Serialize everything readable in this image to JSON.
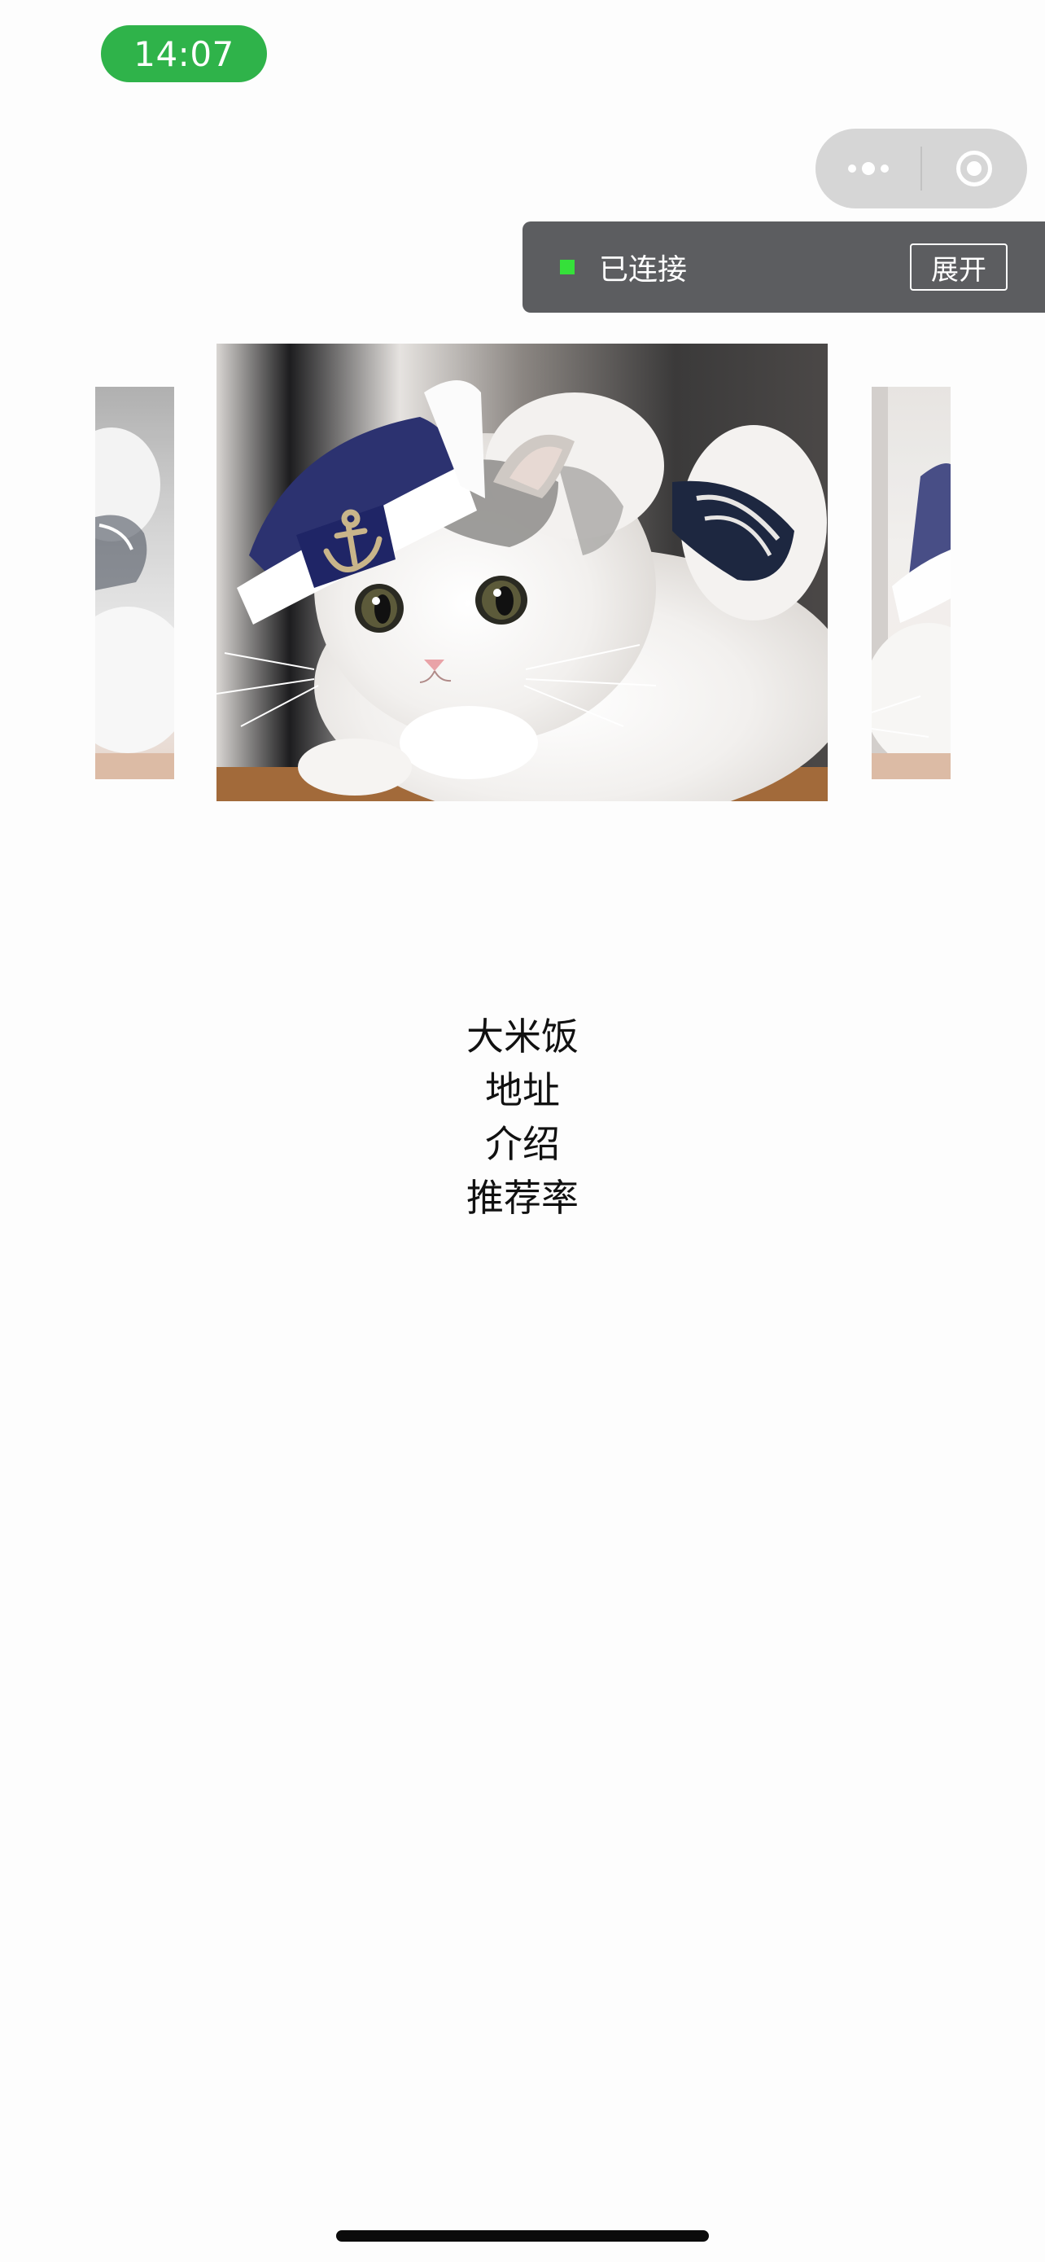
{
  "status_bar": {
    "time": "14:07",
    "time_pill_color": "#2fb34a"
  },
  "capsule": {
    "menu_icon": "more-dots-icon",
    "close_icon": "target-circle-icon"
  },
  "connection_panel": {
    "status_label": "已连接",
    "status_color": "#35e03a",
    "expand_label": "展开"
  },
  "carousel": {
    "slides": [
      {
        "image": "cat-photo-sailor-hat",
        "state": "previous"
      },
      {
        "image": "cat-photo-sailor-hat",
        "state": "active"
      },
      {
        "image": "cat-photo-sailor-hat",
        "state": "next"
      }
    ]
  },
  "info": {
    "name": "大米饭",
    "address": "地址",
    "intro": "介绍",
    "rate": "推荐率"
  }
}
